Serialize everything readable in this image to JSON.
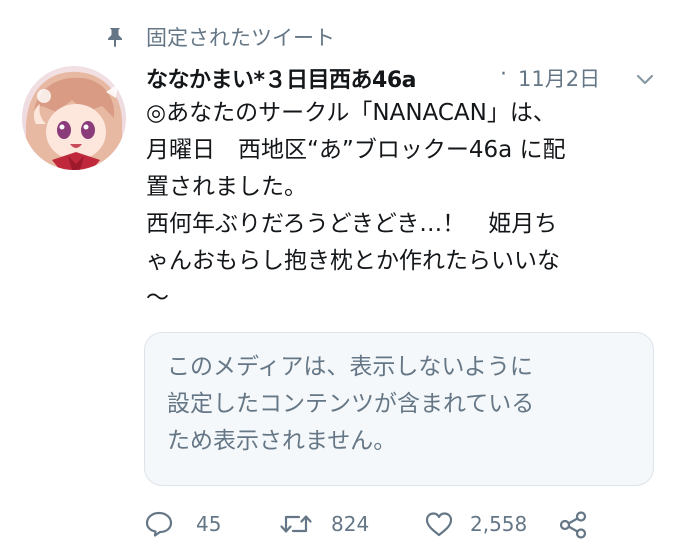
{
  "pinned": {
    "label": "固定されたツイート",
    "icon": "pin-icon"
  },
  "tweet": {
    "display_name": "ななかまい*３日目西あ46a",
    "separator": "·",
    "date": "11月2日",
    "text_lines": [
      "◎あなたのサークル「NANACAN」は、",
      "月曜日　西地区“あ”ブロックー46a に配",
      "置されました。",
      "西何年ぶりだろうどきどき…！　姫月ち",
      "ゃんおもらし抱き枕とか作れたらいいな",
      "〜"
    ],
    "media_notice_lines": [
      "このメディアは、表示しないように",
      "設定したコンテンツが含まれている",
      "ため表示されません。"
    ]
  },
  "actions": {
    "reply_count": "45",
    "retweet_count": "824",
    "like_count": "2,558"
  },
  "colors": {
    "text": "#14171a",
    "secondary": "#657786",
    "media_bg": "#f5f8fa",
    "media_border": "#dce3ea"
  }
}
